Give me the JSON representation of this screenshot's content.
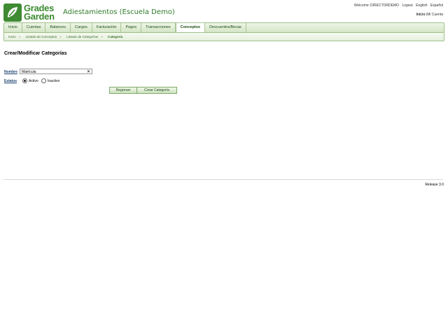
{
  "brand": {
    "line1": "Grades",
    "line2": "Garden",
    "logo_icon": "leaf-logo-icon"
  },
  "school_name": "Adiestamientos (Escuela Demo)",
  "top": {
    "welcome": "Welcome:",
    "user": "DIRECTORDEMO",
    "logout": "Logout",
    "english": "English",
    "spanish": "Español"
  },
  "account": {
    "home": "Inicio",
    "sep": "|",
    "mine": "Mi Cuenta"
  },
  "nav": [
    {
      "label": "Inicio"
    },
    {
      "label": "Cuentas"
    },
    {
      "label": "Balances"
    },
    {
      "label": "Cargos"
    },
    {
      "label": "Facturación"
    },
    {
      "label": "Pagos"
    },
    {
      "label": "Transacciones"
    },
    {
      "label": "Conceptos",
      "active": true
    },
    {
      "label": "Descuentos/Becas"
    }
  ],
  "breadcrumb": [
    "Inicio",
    "Listado de Conceptos",
    "Listado de Categorías",
    "Categoría"
  ],
  "form": {
    "title": "Crear/Modificar Categorías",
    "name_label": "Nombre",
    "name_value": "Matrícula",
    "status_label": "Estatus",
    "active_label": "Activo",
    "inactive_label": "Inactivo",
    "back_button": "Regresar",
    "create_button": "Crear Categoría"
  },
  "footer": {
    "release": "Release 3.0"
  }
}
